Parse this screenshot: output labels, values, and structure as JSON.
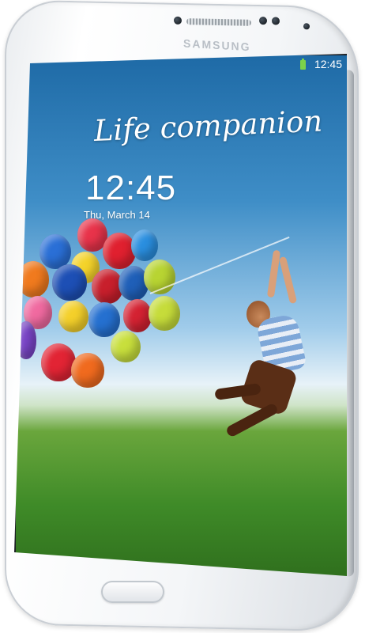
{
  "device": {
    "brand": "SAMSUNG",
    "body_color": "#f4f6f8",
    "icons": [
      "front-camera-icon",
      "proximity-sensor-icon",
      "battery-icon"
    ]
  },
  "status_bar": {
    "time": "12:45",
    "battery_color": "#7bd24a"
  },
  "lock_screen": {
    "tagline": "Life companion",
    "clock": "12:45",
    "date": "Thu, March 14"
  }
}
